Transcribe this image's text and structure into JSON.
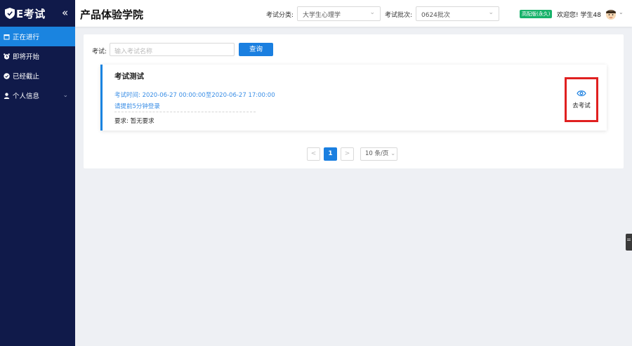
{
  "sidebar": {
    "logo_text": "E考试",
    "items": [
      {
        "label": "正在进行",
        "icon": "calendar-icon",
        "active": true
      },
      {
        "label": "即将开始",
        "icon": "alarm-clock-icon",
        "active": false
      },
      {
        "label": "已经截止",
        "icon": "check-circle-icon",
        "active": false
      },
      {
        "label": "个人信息",
        "icon": "user-icon",
        "active": false
      }
    ]
  },
  "header": {
    "title": "产品体验学院",
    "category_label": "考试分类:",
    "category_value": "大学生心理学",
    "batch_label": "考试批次:",
    "batch_value": "0624批次",
    "badge": "高配版(永久)",
    "welcome": "欢迎您! 学生48"
  },
  "search": {
    "label": "考试:",
    "placeholder": "输入考试名称",
    "button": "查询"
  },
  "exam": {
    "title": "考试测试",
    "time": "考试时间: 2020-06-27 00:00:00至2020-06-27 17:00:00",
    "tip": "请提前5分钟登录",
    "requirement": "要求: 暂无要求",
    "action": "去考试"
  },
  "pagination": {
    "prev": "<",
    "current": "1",
    "next": ">",
    "page_size": "10 条/页"
  },
  "colors": {
    "sidebar_bg": "#101a4a",
    "accent": "#1a7fe0",
    "badge": "#17b26a",
    "highlight": "#e02020"
  }
}
